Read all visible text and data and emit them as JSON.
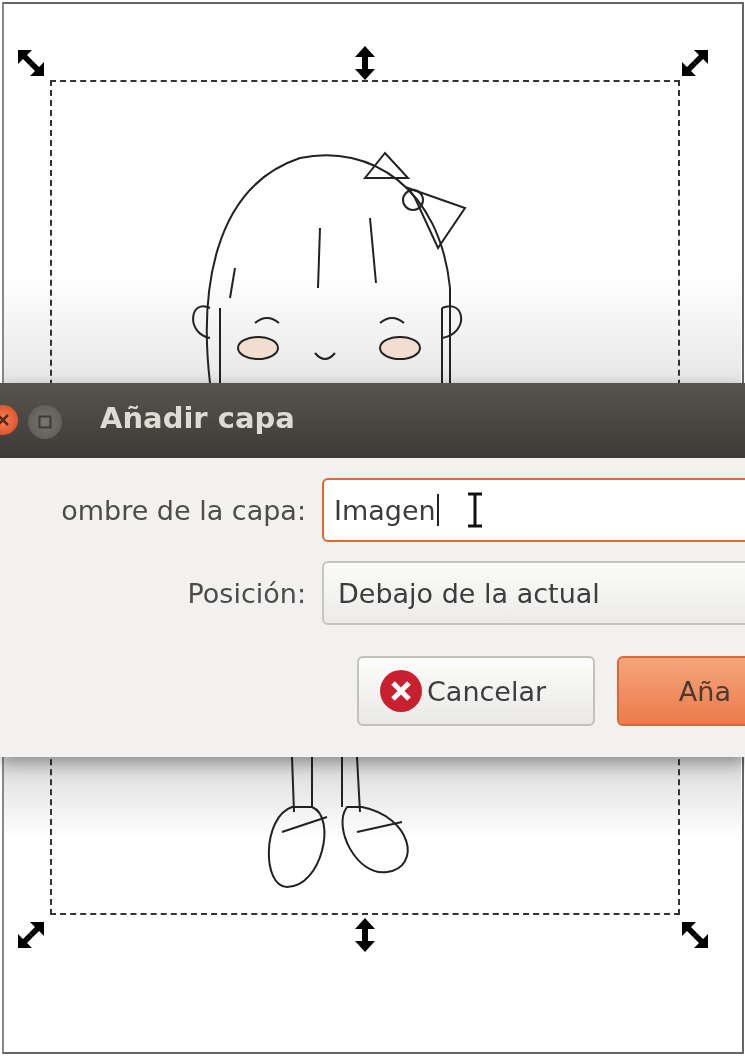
{
  "dialog": {
    "title": "Añadir capa",
    "fields": [
      {
        "kind": "text",
        "label": "ombre de la capa:",
        "value": "Imagen",
        "focused": true
      },
      {
        "kind": "dropdown",
        "label": "Posición:",
        "value": "Debajo de la actual",
        "focused": false
      }
    ],
    "buttons": [
      {
        "kind": "cancel",
        "label": "Cancelar"
      },
      {
        "kind": "primary",
        "label": "Aña"
      }
    ]
  }
}
